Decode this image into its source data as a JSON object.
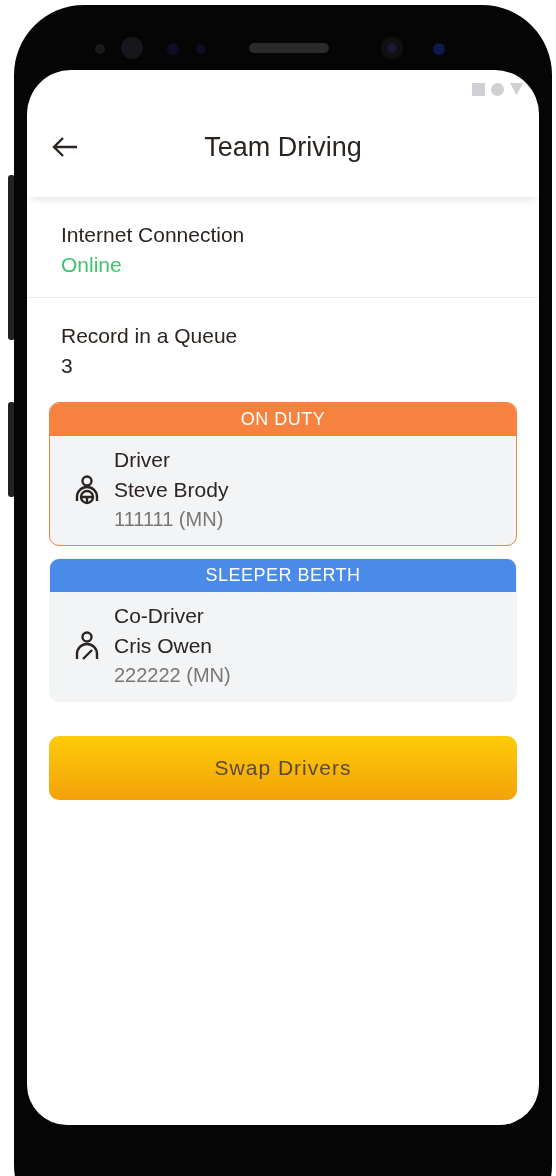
{
  "header": {
    "title": "Team Driving"
  },
  "info": [
    {
      "label": "Internet Connection",
      "value": "Online",
      "kind": "status"
    },
    {
      "label": "Record in a Queue",
      "value": "3",
      "kind": "plain"
    }
  ],
  "drivers": [
    {
      "status": "ON DUTY",
      "color": "#f7813e",
      "active": true,
      "kind": "driver",
      "role": "Driver",
      "name": "Steve Brody",
      "id": "111111 (MN)"
    },
    {
      "status": "SLEEPER BERTH",
      "color": "#4a8ae8",
      "active": false,
      "kind": "co_driver",
      "role": "Co-Driver",
      "name": "Cris Owen",
      "id": "222222 (MN)"
    }
  ],
  "action": {
    "label": "Swap Drivers"
  }
}
